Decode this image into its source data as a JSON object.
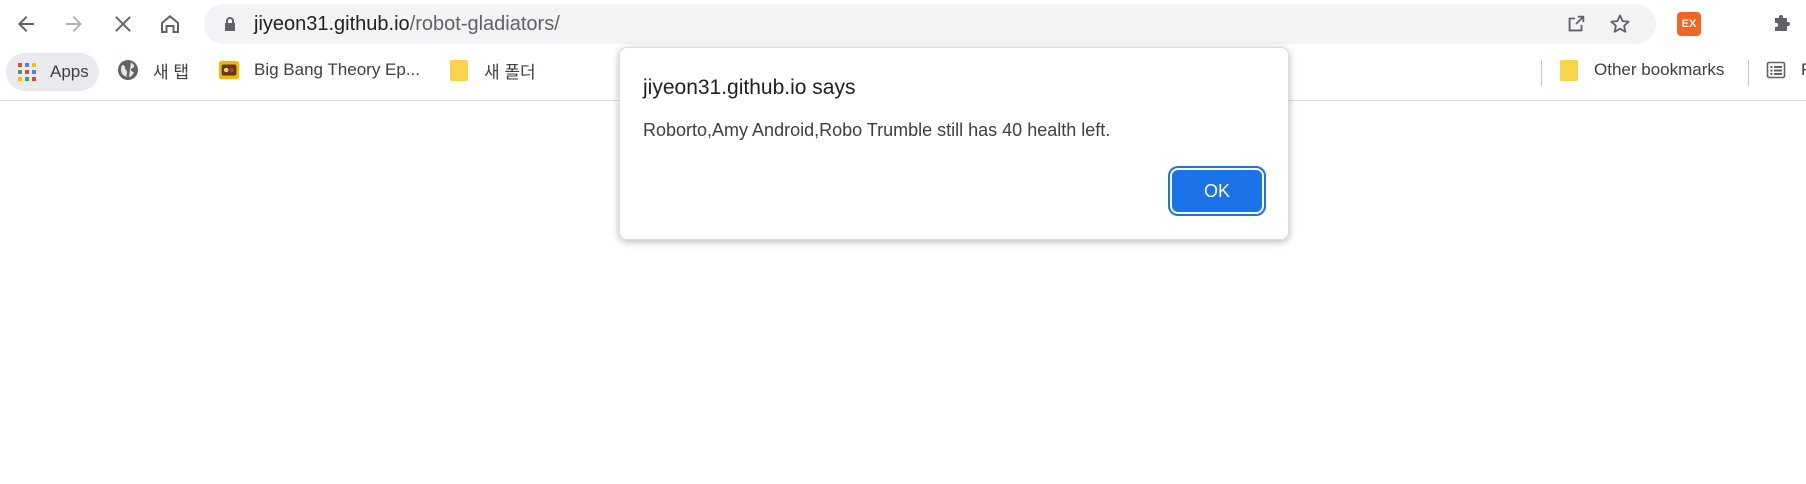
{
  "toolbar": {
    "back_icon": "arrow-left-icon",
    "forward_icon": "arrow-right-icon",
    "stop_icon": "close-icon",
    "home_icon": "home-icon",
    "lock_icon": "lock-icon",
    "url_host": "jiyeon31.github.io",
    "url_path": "/robot-gladiators/",
    "share_icon": "share-icon",
    "star_icon": "star-icon",
    "extension_badge": "EX",
    "extensions_icon": "puzzle-icon"
  },
  "bookmarks": {
    "apps_label": "Apps",
    "items": [
      {
        "label": "새 탭",
        "icon": "globe-icon"
      },
      {
        "label": "Big Bang Theory Ep...",
        "icon": "site-favicon"
      },
      {
        "label": "새 폴더",
        "icon": "folder-icon"
      }
    ],
    "other_label": "Other bookmarks",
    "reading_list_partial": "R"
  },
  "dialog": {
    "title": "jiyeon31.github.io says",
    "message": "Roborto,Amy Android,Robo Trumble still has 40 health left.",
    "ok_label": "OK"
  },
  "colors": {
    "accent": "#1a73e8",
    "omnibox_bg": "#f1f3f4",
    "folder": "#f7d44a",
    "extension_badge": "#f26522"
  }
}
